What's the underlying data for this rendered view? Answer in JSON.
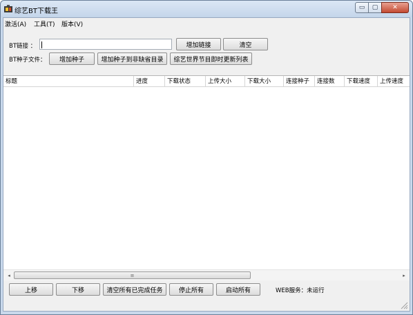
{
  "window": {
    "title": "综艺BT下载王",
    "min_glyph": "▭",
    "max_glyph": "▢",
    "close_glyph": "✕"
  },
  "menu": [
    {
      "label": "激活(A)"
    },
    {
      "label": "工具(T)"
    },
    {
      "label": "版本(V)"
    }
  ],
  "bt_link": {
    "label": "BT链接 ：",
    "value": ""
  },
  "buttons": {
    "add_link": "增加链接",
    "clear": "清空",
    "add_seed": "增加种子",
    "add_seed_default_dir": "增加种子到非缺省目录",
    "refresh_list": "综艺世界节目即时更新列表"
  },
  "bt_seed_file": {
    "label": "BT种子文件："
  },
  "table": {
    "columns": [
      "标题",
      "进度",
      "下载状态",
      "上传大小",
      "下载大小",
      "连接种子",
      "连接数",
      "下载速度",
      "上传速度"
    ],
    "rows": []
  },
  "scrollbar": {
    "left_glyph": "◂",
    "right_glyph": "▸",
    "thumb_glyph": "≡"
  },
  "bottom_buttons": {
    "up": "上移",
    "down": "下移",
    "clear_completed": "清空所有已完成任务",
    "stop_all": "停止所有",
    "start_all": "启动所有"
  },
  "web_service": {
    "label": "WEB服务：未运行"
  }
}
